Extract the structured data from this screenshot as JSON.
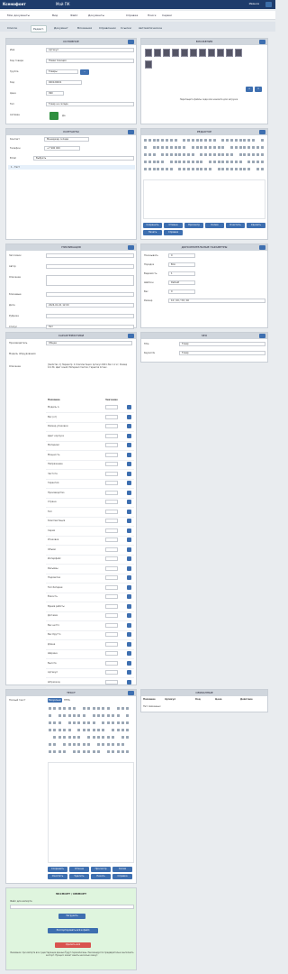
{
  "topbar": {
    "brand": "Ксенофонт",
    "tab": "Мой ПК",
    "user": "Иванов"
  },
  "menu": [
    "Мои документы",
    "Вид",
    "Файл",
    "Документы",
    "Справка",
    "Поиск",
    "Сервис"
  ],
  "tabs": [
    "Список",
    "Редакт.",
    "Документ",
    "Вложения",
    "Справочник",
    "Ссылки",
    "Автоматическое"
  ],
  "cards": {
    "props": "ОСНОВНОЕ",
    "attachments": "ВЛОЖЕНИЯ",
    "contacts": "КОНТАКТЫ",
    "editor": "РЕДАКТОР",
    "pub": "ПУБЛИКАЦИЯ",
    "meta": "ДОПОЛНИТЕЛЬНЫЕ ПАРАМЕТРЫ",
    "chars": "ХАРАКТЕРИСТИКИ",
    "seo": "SEO",
    "text2": "ТЕКСТ",
    "related": "СВЯЗАННЫЕ",
    "export": "ЭКСПОРТ / ИМПОРТ"
  },
  "props": {
    "fields": [
      {
        "l": "Имя",
        "v": "Артикул"
      },
      {
        "l": "Код товара",
        "v": "Новая позиция"
      },
      {
        "l": "Группа",
        "v": "Товары"
      },
      {
        "l": "Код",
        "v": "000120001"
      },
      {
        "l": "Цена",
        "v": "990"
      },
      {
        "l": "Тип",
        "v": "Товар на складе"
      },
      {
        "l": "Активен",
        "v": "Да"
      }
    ]
  },
  "attach": {
    "caption": "Перетащите файлы сюда или нажмите для загрузки"
  },
  "contacts": {
    "fields": [
      {
        "l": "Контакт",
        "v": "Менеджер склада"
      },
      {
        "l": "Телефон",
        "v": "+7 900 000"
      },
      {
        "l": "Email",
        "v": "Выбрать"
      }
    ],
    "row": "1 - Тест"
  },
  "editor": {
    "buttons": [
      "Сохранить",
      "Отмена",
      "Просмотр",
      "Копия",
      "Очистить",
      "Удалить",
      "Печать",
      "Справка"
    ]
  },
  "pub": {
    "fields": [
      "Заголовок",
      "Автор",
      "Описание",
      "Ключевые",
      "Дата",
      "Рубрика",
      "Статус"
    ],
    "values": [
      "",
      "",
      "",
      "",
      "2024-01-01 12:00",
      "",
      "Нет"
    ]
  },
  "meta": {
    "fields": [
      "Показывать",
      "Порядок",
      "Видимость",
      "Шаблон",
      "Вес",
      "Размер"
    ],
    "values": [
      "0",
      "Всё",
      "1",
      "Default",
      "0",
      "10 / 20 / 30 / 40"
    ]
  },
  "chars": {
    "header": [
      "Название",
      "Значение"
    ],
    "top": [
      {
        "l": "Производитель",
        "v": "Общее"
      },
      {
        "l": "Модель оборудования",
        "v": ""
      },
      {
        "l": "Описание",
        "v": "[Свойство: 1] Параметр: 2; Комплектация: Артикул 0001; Вес 1.2 кг; Размер 12×34; Цвет синий; Материал пластик; Гарантия 12 мес."
      }
    ],
    "rows": [
      "Модель А",
      "Вес (кг)",
      "Размер упаковки",
      "Цвет корпуса",
      "Материал",
      "Мощность",
      "Напряжение",
      "Частота",
      "Гарантия",
      "Производство",
      "Страна",
      "Тип",
      "Комплектация",
      "Серия",
      "Упаковка",
      "Объём",
      "Интерфейс",
      "Разъёмы",
      "Подсветка",
      "Тип батареи",
      "Ёмкость",
      "Время работы",
      "Датчики",
      "Вес нетто",
      "Вес брутто",
      "Длина",
      "Ширина",
      "Высота",
      "Артикул",
      "Штрихкод"
    ]
  },
  "seo": {
    "fields": [
      {
        "l": "Title",
        "v": "Товар"
      },
      {
        "l": "Keywords",
        "v": "Товар"
      }
    ]
  },
  "text2": {
    "label": "Полный текст",
    "tabs": [
      "Визуально",
      "HTML"
    ],
    "buttons": [
      "Сохранить",
      "Отмена",
      "Просмотр",
      "Копия",
      "Очистить",
      "Удалить",
      "Печать",
      "Справка"
    ]
  },
  "related": {
    "header": [
      "Название",
      "Артикул",
      "Код",
      "Цена",
      "Действие"
    ],
    "row": "Нет связанных"
  },
  "export": {
    "title": "ЭКСПОРТ / ИМПОРТ",
    "label": "Файл для импорта",
    "btn1": "Загрузить",
    "btn2": "Экспортировать всё в файл",
    "btn3": "Удалить всё",
    "note": "Внимание: при импорте все существующие данные будут перезаписаны. Рекомендуется предварительно выполнить экспорт. Процесс может занять несколько минут."
  },
  "colors": {
    "accent": "#3e6fb0",
    "top": "#1e3c6b",
    "danger": "#d9534f",
    "green": "#dff5de"
  }
}
